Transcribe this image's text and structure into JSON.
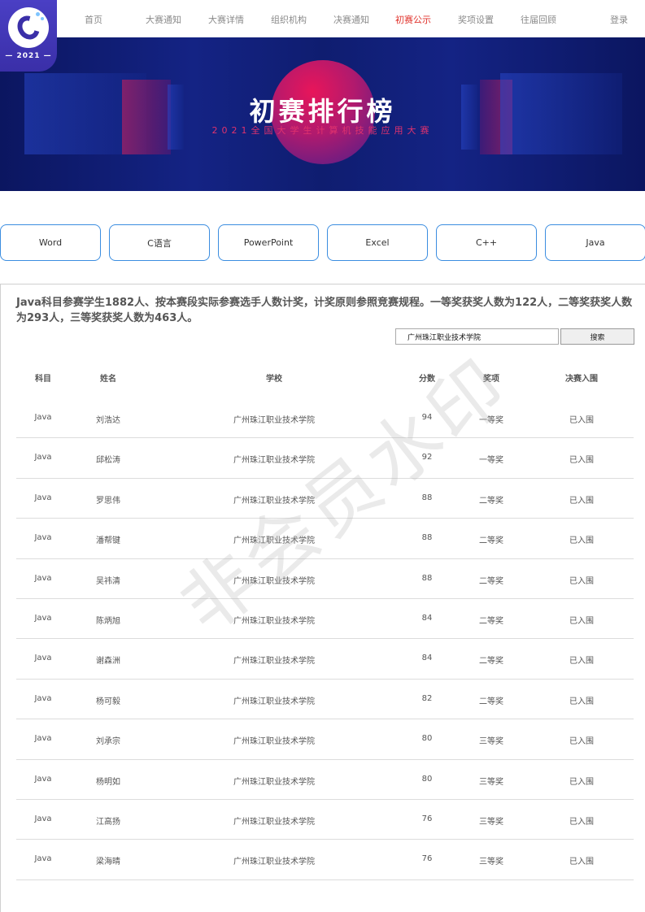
{
  "logo": {
    "year": "— 2021 —"
  },
  "nav": {
    "items": [
      {
        "label": "首页",
        "active": false
      },
      {
        "label": "大赛通知",
        "active": false
      },
      {
        "label": "大赛详情",
        "active": false
      },
      {
        "label": "组织机构",
        "active": false
      },
      {
        "label": "决赛通知",
        "active": false
      },
      {
        "label": "初赛公示",
        "active": true
      },
      {
        "label": "奖项设置",
        "active": false
      },
      {
        "label": "往届回顾",
        "active": false
      }
    ],
    "login": "登录"
  },
  "banner": {
    "title": "初赛排行榜",
    "subtitle": "2021全国大学生计算机技能应用大赛"
  },
  "tabs": [
    "Word",
    "C语言",
    "PowerPoint",
    "Excel",
    "C++",
    "Java"
  ],
  "notice": "Java科目参赛学生1882人、按本赛段实际参赛选手人数计奖，计奖原则参照竞赛规程。一等奖获奖人数为122人，二等奖获奖人数为293人，三等奖获奖人数为463人。",
  "search": {
    "value": "广州珠江职业技术学院",
    "button": "搜索"
  },
  "table": {
    "headers": [
      "科目",
      "姓名",
      "学校",
      "分数",
      "奖项",
      "决赛入围"
    ],
    "rows": [
      [
        "Java",
        "刘浩达",
        "广州珠江职业技术学院",
        "94",
        "一等奖",
        "已入围"
      ],
      [
        "Java",
        "邱松涛",
        "广州珠江职业技术学院",
        "92",
        "一等奖",
        "已入围"
      ],
      [
        "Java",
        "罗思伟",
        "广州珠江职业技术学院",
        "88",
        "二等奖",
        "已入围"
      ],
      [
        "Java",
        "潘帮键",
        "广州珠江职业技术学院",
        "88",
        "二等奖",
        "已入围"
      ],
      [
        "Java",
        "吴祎清",
        "广州珠江职业技术学院",
        "88",
        "二等奖",
        "已入围"
      ],
      [
        "Java",
        "陈炳旭",
        "广州珠江职业技术学院",
        "84",
        "二等奖",
        "已入围"
      ],
      [
        "Java",
        "谢森洲",
        "广州珠江职业技术学院",
        "84",
        "二等奖",
        "已入围"
      ],
      [
        "Java",
        "杨可毅",
        "广州珠江职业技术学院",
        "82",
        "二等奖",
        "已入围"
      ],
      [
        "Java",
        "刘承宗",
        "广州珠江职业技术学院",
        "80",
        "三等奖",
        "已入围"
      ],
      [
        "Java",
        "杨明如",
        "广州珠江职业技术学院",
        "80",
        "三等奖",
        "已入围"
      ],
      [
        "Java",
        "江高扬",
        "广州珠江职业技术学院",
        "76",
        "三等奖",
        "已入围"
      ],
      [
        "Java",
        "梁海晴",
        "广州珠江职业技术学院",
        "76",
        "三等奖",
        "已入围"
      ]
    ]
  },
  "watermark": "非会员水印",
  "colors": {
    "accent": "#e0322b",
    "tab_border": "#3b8de0",
    "logo_bg": "#3a2fa8"
  }
}
